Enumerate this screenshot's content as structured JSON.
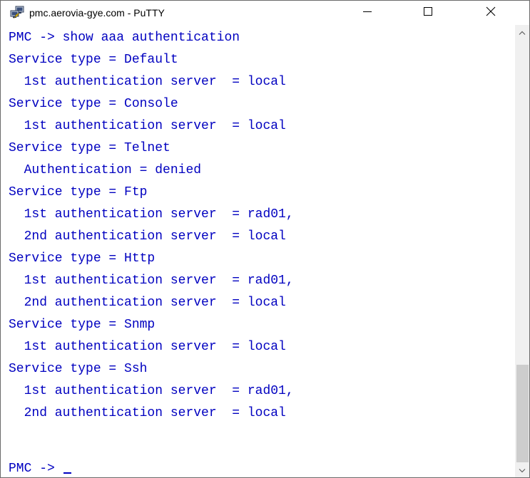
{
  "window": {
    "title": "pmc.aerovia-gye.com - PuTTY",
    "icon": "putty-icon",
    "controls": {
      "minimize_icon": "minimize-icon",
      "maximize_icon": "maximize-icon",
      "close_icon": "close-icon"
    }
  },
  "terminal": {
    "colors": {
      "foreground": "#0000c0",
      "background": "#ffffff"
    },
    "lines": [
      "PMC -> show aaa authentication",
      "Service type = Default",
      "  1st authentication server  = local",
      "Service type = Console",
      "  1st authentication server  = local",
      "Service type = Telnet",
      "  Authentication = denied",
      "Service type = Ftp",
      "  1st authentication server  = rad01,",
      "  2nd authentication server  = local",
      "Service type = Http",
      "  1st authentication server  = rad01,",
      "  2nd authentication server  = local",
      "Service type = Snmp",
      "  1st authentication server  = local",
      "Service type = Ssh",
      "  1st authentication server  = rad01,",
      "  2nd authentication server  = local"
    ],
    "prompt": "PMC -> "
  },
  "scrollbar": {
    "up_icon": "scroll-up-arrow-icon",
    "down_icon": "scroll-down-arrow-icon"
  }
}
